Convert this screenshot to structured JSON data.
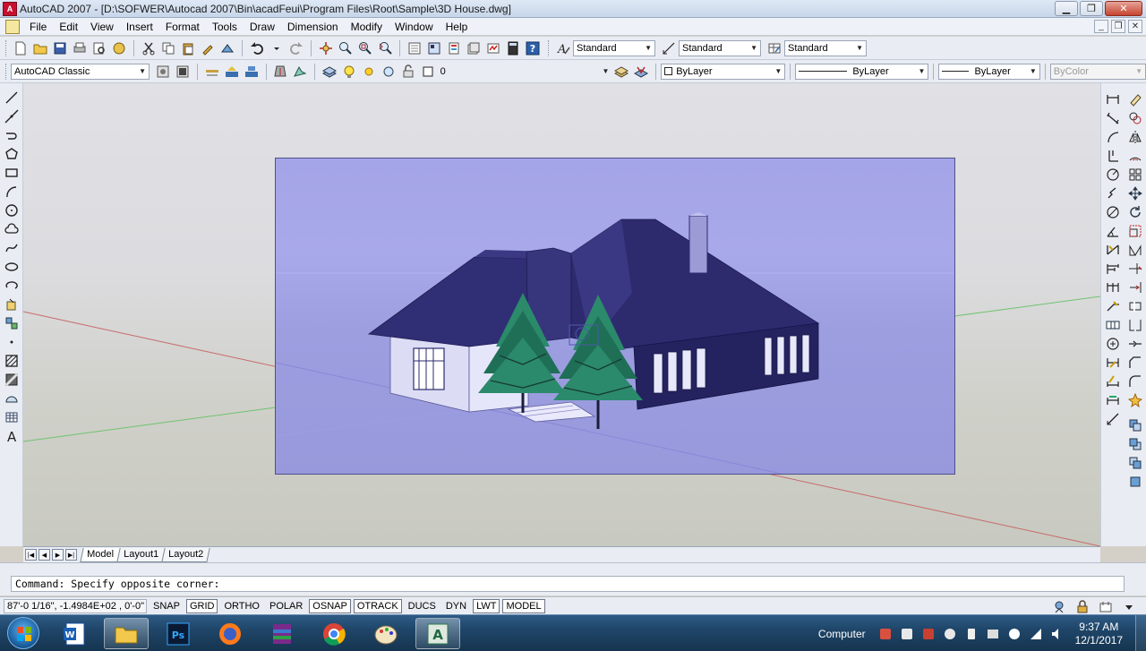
{
  "window": {
    "title": "AutoCAD 2007 - [D:\\SOFWER\\Autocad 2007\\Bin\\acadFeui\\Program Files\\Root\\Sample\\3D House.dwg]",
    "app_icon_label": "A"
  },
  "menu": {
    "items": [
      "File",
      "Edit",
      "View",
      "Insert",
      "Format",
      "Tools",
      "Draw",
      "Dimension",
      "Modify",
      "Window",
      "Help"
    ]
  },
  "toolbar1": {
    "text_style": "Standard",
    "dim_style": "Standard",
    "table_style": "Standard"
  },
  "toolbar2": {
    "workspace": "AutoCAD Classic",
    "layer": "0",
    "color": "ByLayer",
    "linetype": "ByLayer",
    "lineweight": "ByLayer",
    "plot_style": "ByColor"
  },
  "layout_tabs": {
    "tabs": [
      "Model",
      "Layout1",
      "Layout2"
    ],
    "active": "Model"
  },
  "command": {
    "text": "Command: Specify opposite corner:"
  },
  "status": {
    "coordinates": "87'-0 1/16\",  -1.4984E+02 , 0'-0\"",
    "toggles": [
      "SNAP",
      "GRID",
      "ORTHO",
      "POLAR",
      "OSNAP",
      "OTRACK",
      "DUCS",
      "DYN",
      "LWT",
      "MODEL"
    ],
    "pressed": [
      "GRID",
      "OSNAP",
      "OTRACK",
      "LWT",
      "MODEL"
    ]
  },
  "taskbar": {
    "apps": [
      "windows-explorer",
      "word",
      "file-manager",
      "photoshop",
      "firefox",
      "winrar",
      "chrome",
      "paint",
      "autocad"
    ],
    "computer_label": "Computer",
    "time": "9:37 AM",
    "date": "12/1/2017"
  },
  "colors": {
    "viewport_bg": "#a4a4e8",
    "roof": "#2d2b6e",
    "wall_dark": "#25235f",
    "wall_light": "#dcdcf5",
    "tree": "#2b8a6b",
    "x_axis": "#d04a4a",
    "y_axis": "#4cbf4c"
  }
}
